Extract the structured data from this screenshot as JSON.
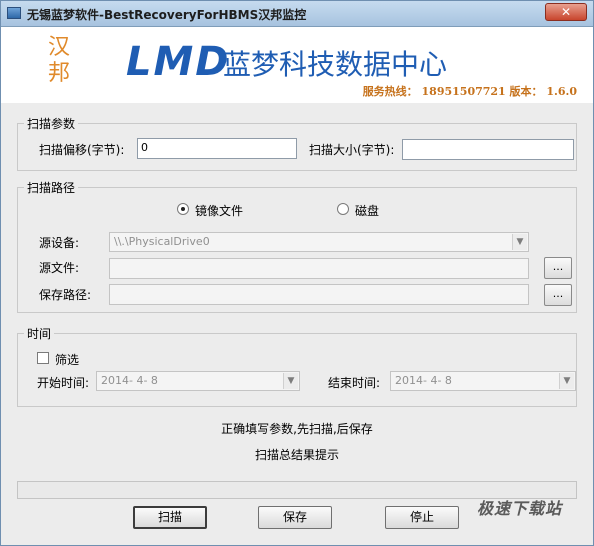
{
  "window": {
    "title": "无锡蓝梦软件-BestRecoveryForHBMS汉邦监控",
    "close_label": "✕"
  },
  "banner": {
    "brand_left": "汉\n邦",
    "logo": "LMD",
    "company": "蓝梦科技数据中心",
    "service_line": "服务热线： 18951507721  版本： 1.6.0"
  },
  "scan_params": {
    "legend": "扫描参数",
    "offset_label": "扫描偏移(字节):",
    "offset_value": "0",
    "size_label": "扫描大小(字节):",
    "size_value": ""
  },
  "scan_path": {
    "legend": "扫描路径",
    "radio_image_label": "镜像文件",
    "radio_disk_label": "磁盘",
    "source_device_label": "源设备:",
    "source_device_value": "\\\\.\\PhysicalDrive0",
    "source_file_label": "源文件:",
    "source_file_value": "",
    "save_path_label": "保存路径:",
    "save_path_value": "",
    "browse_label": "...",
    "image_selected": true
  },
  "time": {
    "legend": "时间",
    "filter_label": "筛选",
    "start_label": "开始时间:",
    "start_value": "2014- 4- 8",
    "end_label": "结束时间:",
    "end_value": "2014- 4- 8"
  },
  "status": {
    "hint": "正确填写参数,先扫描,后保存",
    "result": "扫描总结果提示"
  },
  "buttons": {
    "scan": "扫描",
    "save": "保存",
    "stop": "停止"
  },
  "watermark": "极速下载站"
}
